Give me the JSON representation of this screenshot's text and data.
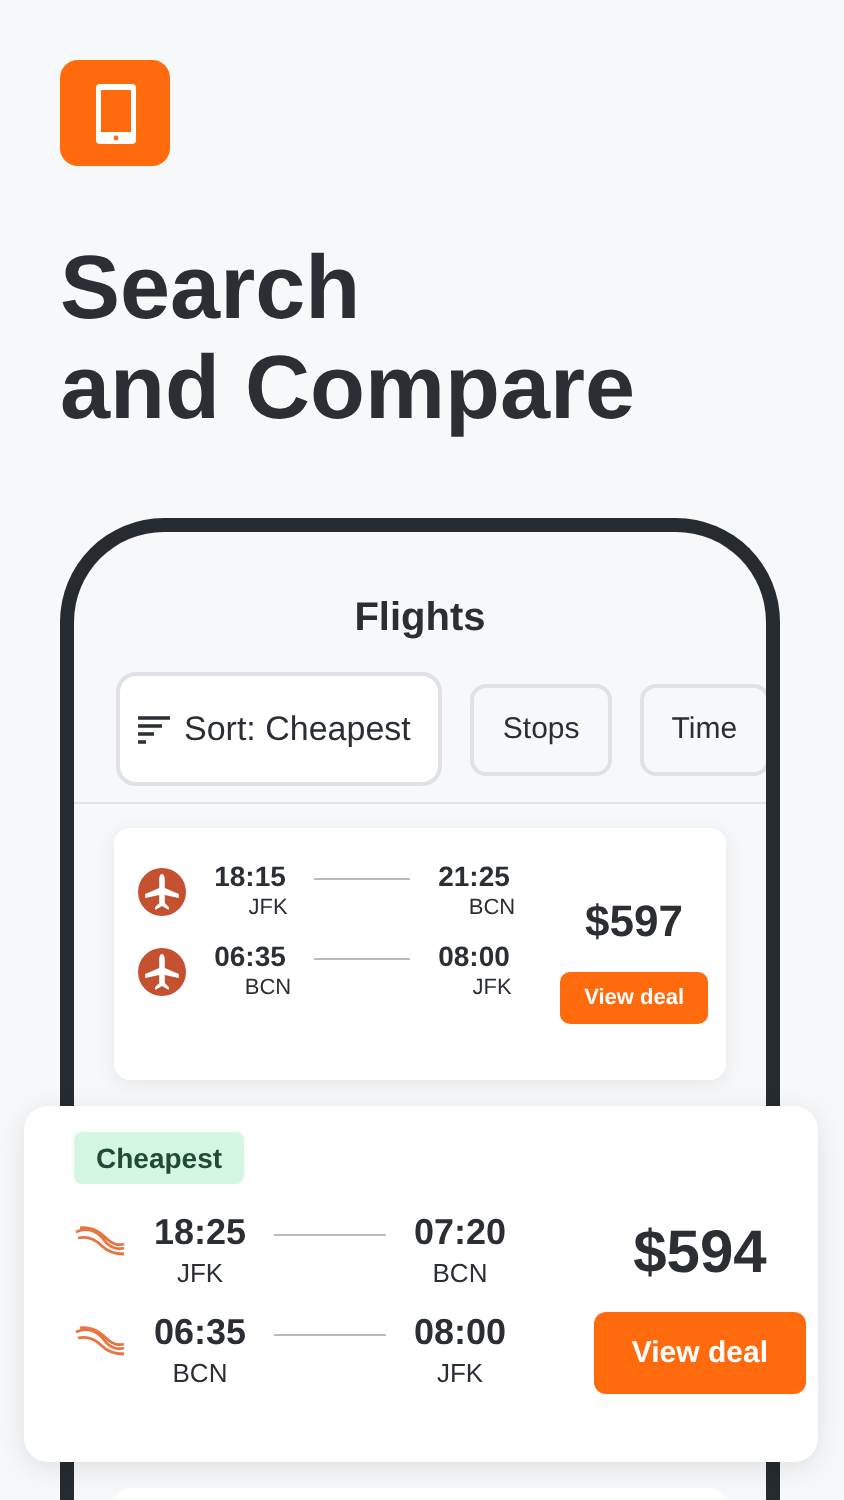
{
  "headline": [
    "Search",
    "and Compare"
  ],
  "screen": {
    "title": "Flights",
    "filters": [
      {
        "label": "Sort: Cheapest",
        "kind": "sort"
      },
      {
        "label": "Stops",
        "kind": "chip"
      },
      {
        "label": "Time",
        "kind": "chip"
      }
    ],
    "results": [
      {
        "featured": false,
        "price": "$597",
        "button": "View deal",
        "legs": [
          {
            "kind": "plane",
            "depart_time": "18:15",
            "depart_airport": "JFK",
            "arrive_time": "21:25",
            "arrive_airport": "BCN"
          },
          {
            "kind": "plane",
            "depart_time": "06:35",
            "depart_airport": "BCN",
            "arrive_time": "08:00",
            "arrive_airport": "JFK"
          }
        ]
      },
      {
        "featured": true,
        "badge": "Cheapest",
        "price": "$594",
        "button": "View deal",
        "legs": [
          {
            "kind": "wave",
            "depart_time": "18:25",
            "depart_airport": "JFK",
            "arrive_time": "07:20",
            "arrive_airport": "BCN"
          },
          {
            "kind": "wave",
            "depart_time": "06:35",
            "depart_airport": "BCN",
            "arrive_time": "08:00",
            "arrive_airport": "JFK"
          }
        ]
      }
    ]
  }
}
